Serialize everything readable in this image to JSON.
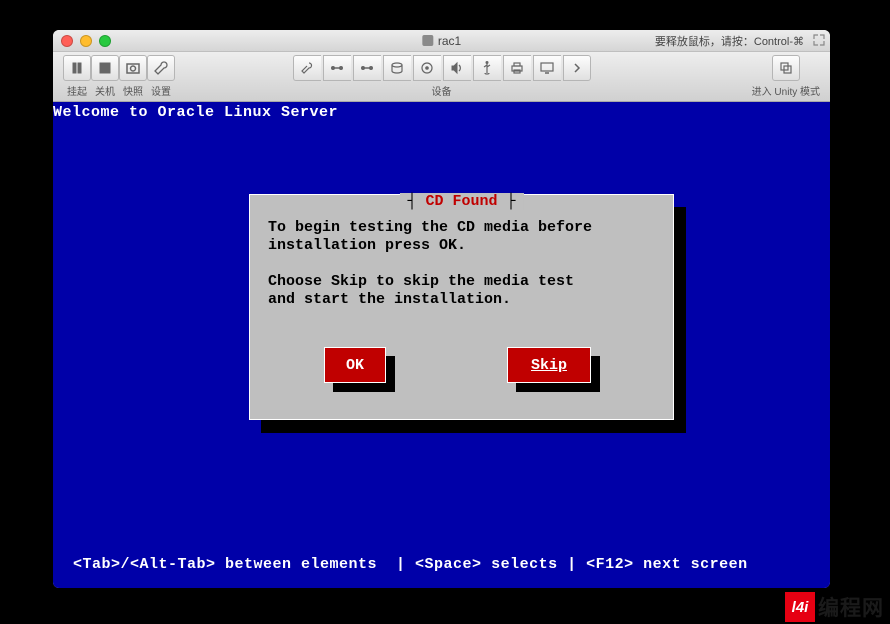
{
  "window": {
    "title": "rac1",
    "hint_right": "要释放鼠标，请按：Control-⌘"
  },
  "toolbar": {
    "suspend": "挂起",
    "poweroff": "关机",
    "snapshot": "快照",
    "settings": "设置",
    "devices": "设备",
    "unity": "进入 Unity 模式"
  },
  "console": {
    "welcome": "Welcome to Oracle Linux Server",
    "hint": "<Tab>/<Alt-Tab> between elements  | <Space> selects | <F12> next screen"
  },
  "dialog": {
    "title_dash_left": "┤ ",
    "title_text": "CD Found",
    "title_dash_right": " ├",
    "line1": "To begin testing the CD media before",
    "line2": "installation press OK.",
    "line3": "",
    "line4": "Choose Skip to skip the media test",
    "line5": "and start the installation.",
    "ok": "OK",
    "skip": "Skip"
  },
  "watermark": {
    "badge": "l4i",
    "text": "编程网"
  }
}
